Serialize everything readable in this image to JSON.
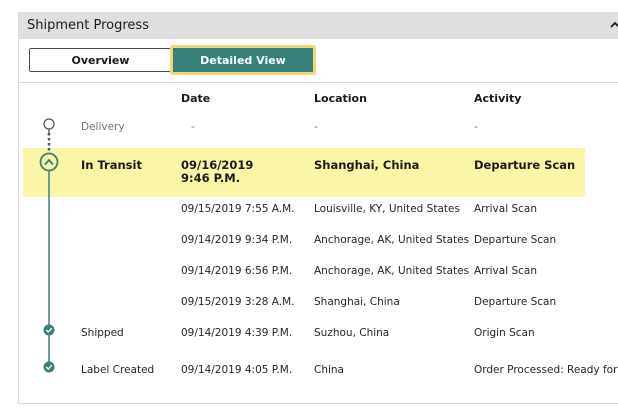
{
  "panel": {
    "title": "Shipment Progress"
  },
  "tabs": {
    "overview": "Overview",
    "detailed": "Detailed View",
    "active": "Detailed View"
  },
  "columns": {
    "date": "Date",
    "location": "Location",
    "activity": "Activity"
  },
  "delivery": {
    "status": "Delivery",
    "date": "-",
    "location": "-",
    "activity": "-"
  },
  "current": {
    "status": "In Transit",
    "date": "09/16/2019",
    "time": "9:46 P.M.",
    "location": "Shanghai, China",
    "activity": "Departure Scan"
  },
  "history": [
    {
      "date": "09/15/2019  7:55 A.M.",
      "location": "Louisville, KY, United States",
      "activity": "Arrival Scan"
    },
    {
      "date": "09/14/2019  9:34 P.M.",
      "location": "Anchorage, AK, United States",
      "activity": "Departure Scan"
    },
    {
      "date": "09/14/2019  6:56 P.M.",
      "location": "Anchorage, AK, United States",
      "activity": "Arrival Scan"
    },
    {
      "date": "09/15/2019  3:28 A.M.",
      "location": "Shanghai, China",
      "activity": "Departure Scan"
    }
  ],
  "shipped": {
    "status": "Shipped",
    "date": "09/14/2019  4:39 P.M.",
    "location": "Suzhou, China",
    "activity": "Origin Scan"
  },
  "label_created": {
    "status": "Label Created",
    "date": "09/14/2019  4:05 P.M.",
    "location": "China",
    "activity": "Order Processed: Ready for UPS"
  },
  "colors": {
    "accent": "#38807a",
    "highlight": "#fbf5a8",
    "focus_ring": "#f4d67a",
    "header_bg": "#dfdfdf"
  },
  "icons": {
    "collapse": "chevron-up-icon",
    "current": "chevron-up-circle-icon",
    "complete": "check-circle-icon",
    "pending": "pin-icon"
  }
}
